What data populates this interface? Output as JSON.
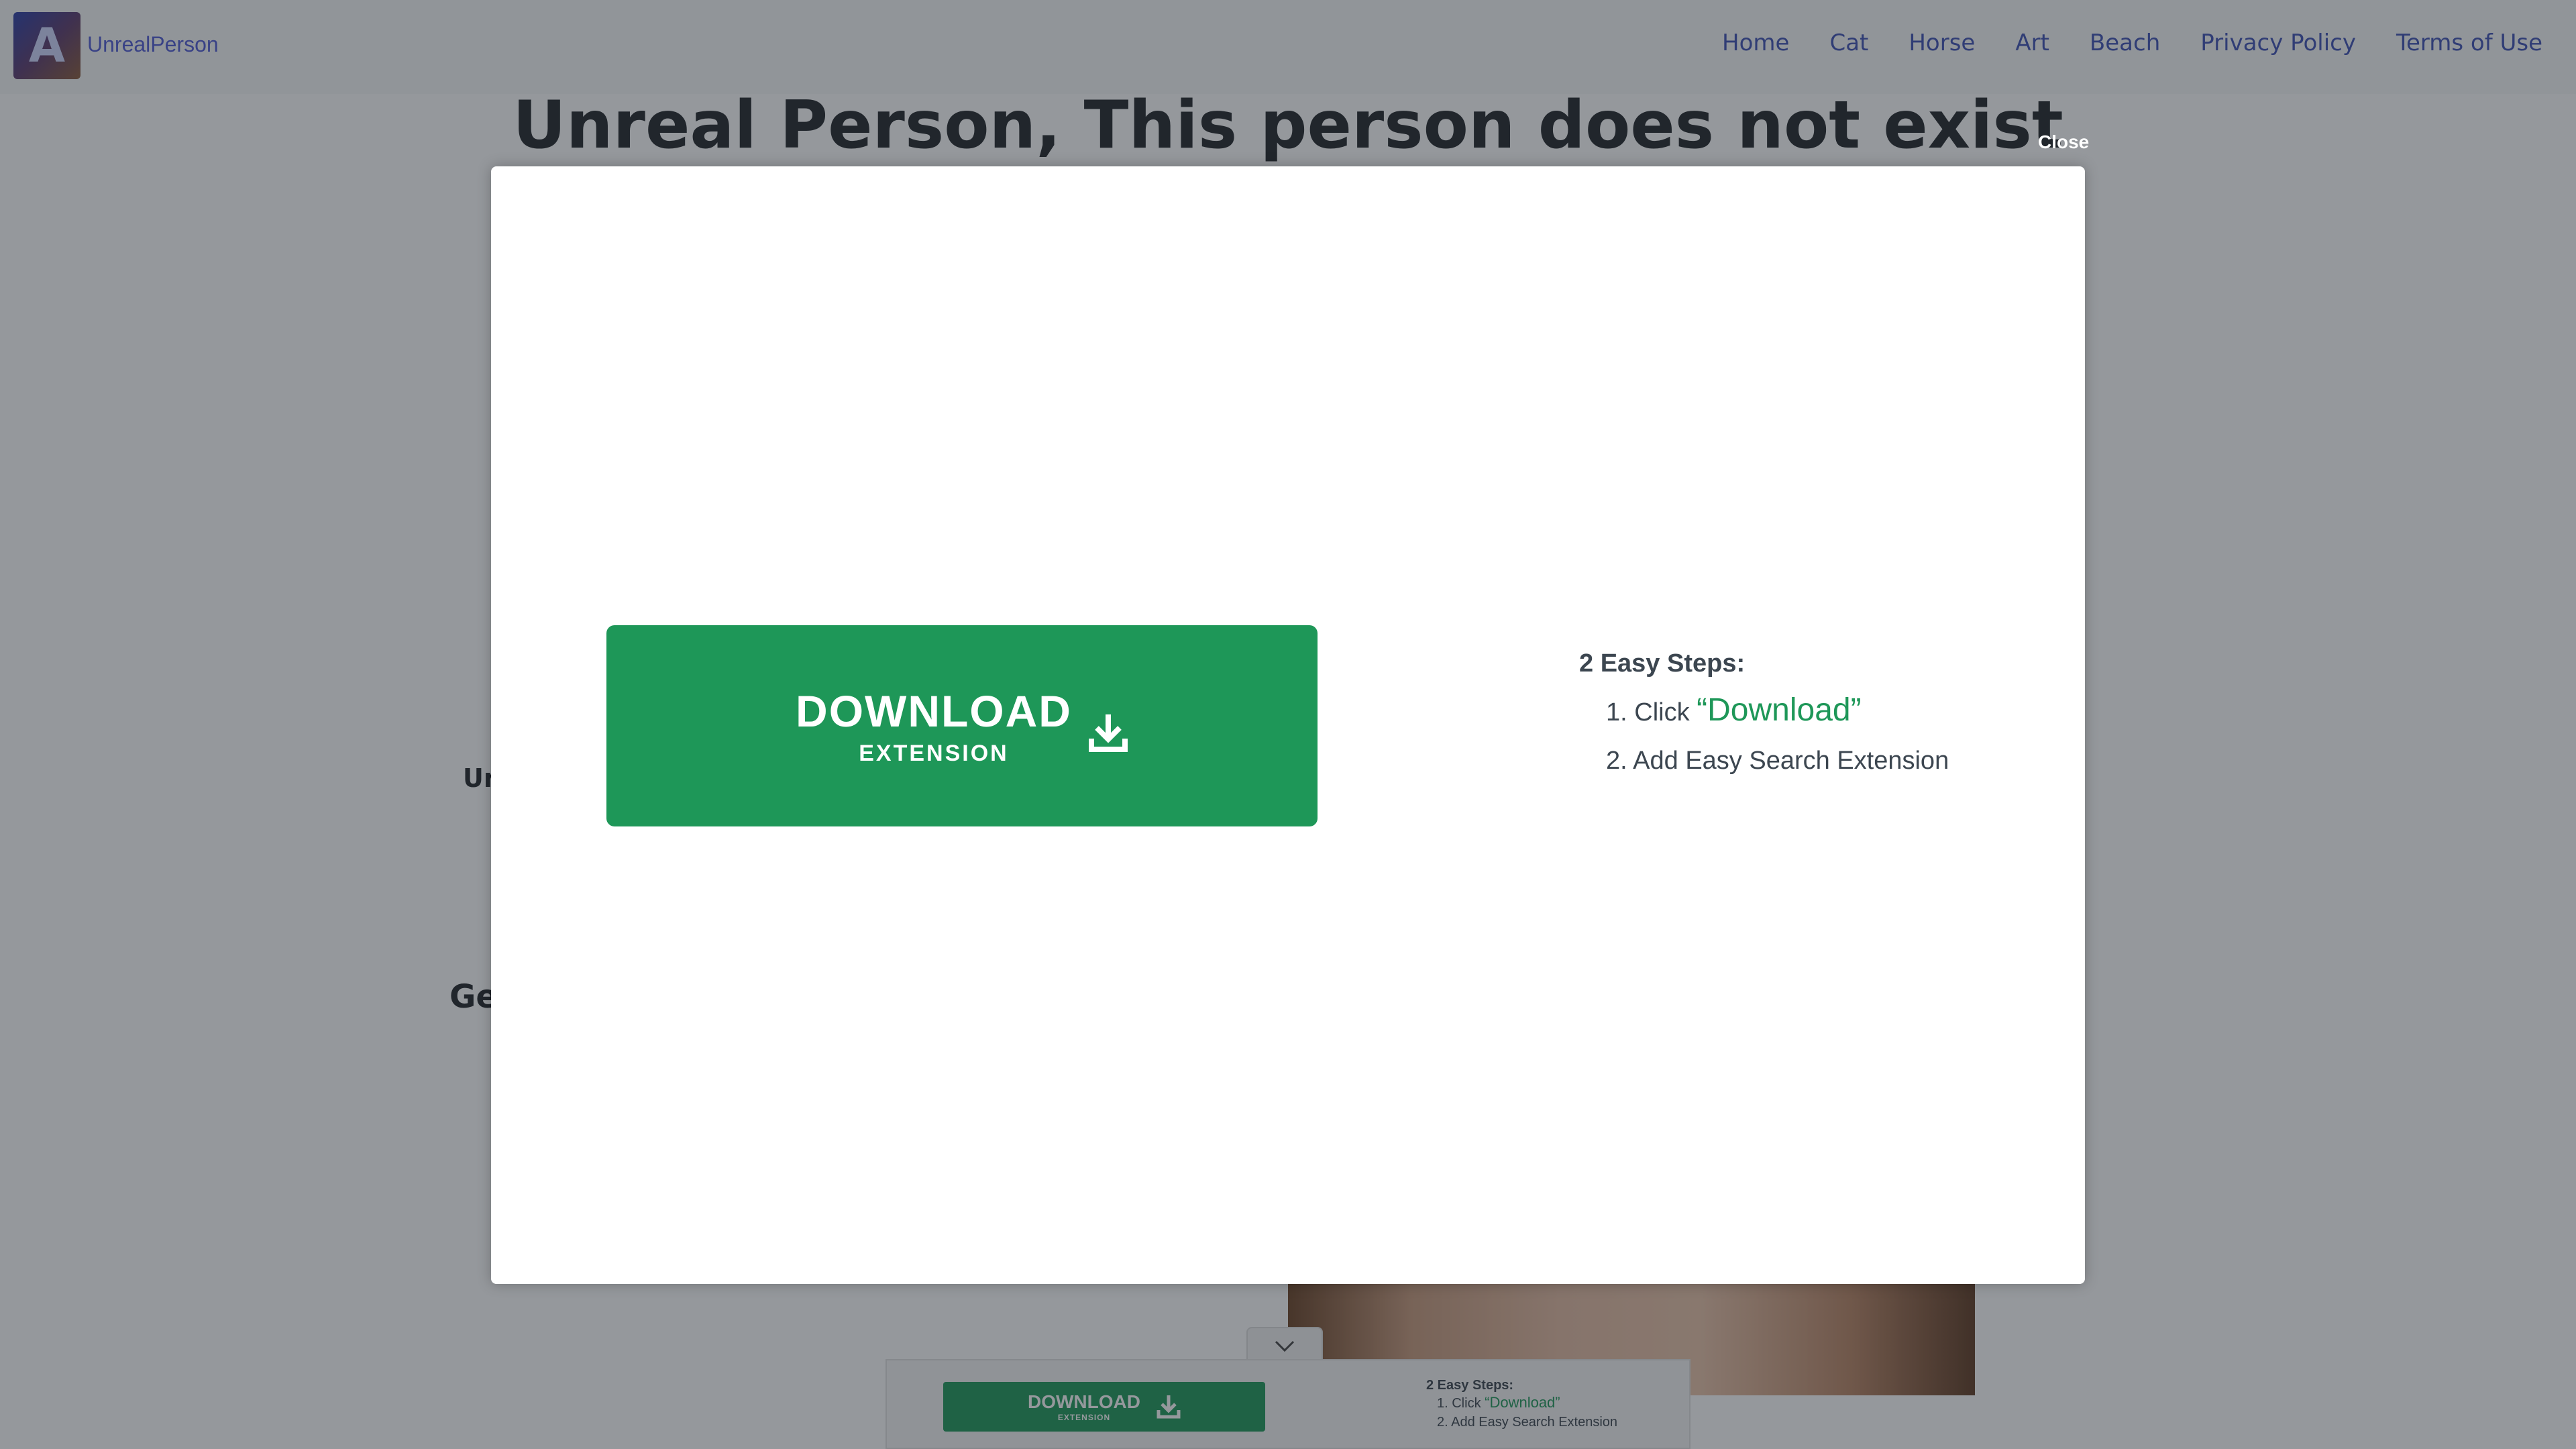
{
  "header": {
    "logo_letter": "A",
    "brand": "UnrealPerson",
    "nav": [
      "Home",
      "Cat",
      "Horse",
      "Art",
      "Beach",
      "Privacy Policy",
      "Terms of Use"
    ]
  },
  "page": {
    "title": "Unreal Person, This person does not exist",
    "fragment_1": "Ur",
    "fragment_2": "Ge"
  },
  "modal": {
    "close_label": "Close",
    "button_main": "DOWNLOAD",
    "button_sub": "EXTENSION",
    "steps_title": "2 Easy Steps:",
    "step1_prefix": "1. Click ",
    "step1_highlight": "“Download”",
    "step2": "2. Add Easy Search Extension"
  },
  "bottom_ad": {
    "button_main": "DOWNLOAD",
    "button_sub": "EXTENSION",
    "steps_title": "2 Easy Steps:",
    "step1_prefix": "1. Click ",
    "step1_highlight": "“Download”",
    "step2": "2. Add Easy Search Extension"
  },
  "colors": {
    "accent_green": "#1e9758",
    "nav_link": "#3f51b5",
    "overlay": "rgba(33,40,48,0.48)"
  },
  "icons": {
    "download": "download-icon",
    "collapse": "chevron-down-icon"
  }
}
